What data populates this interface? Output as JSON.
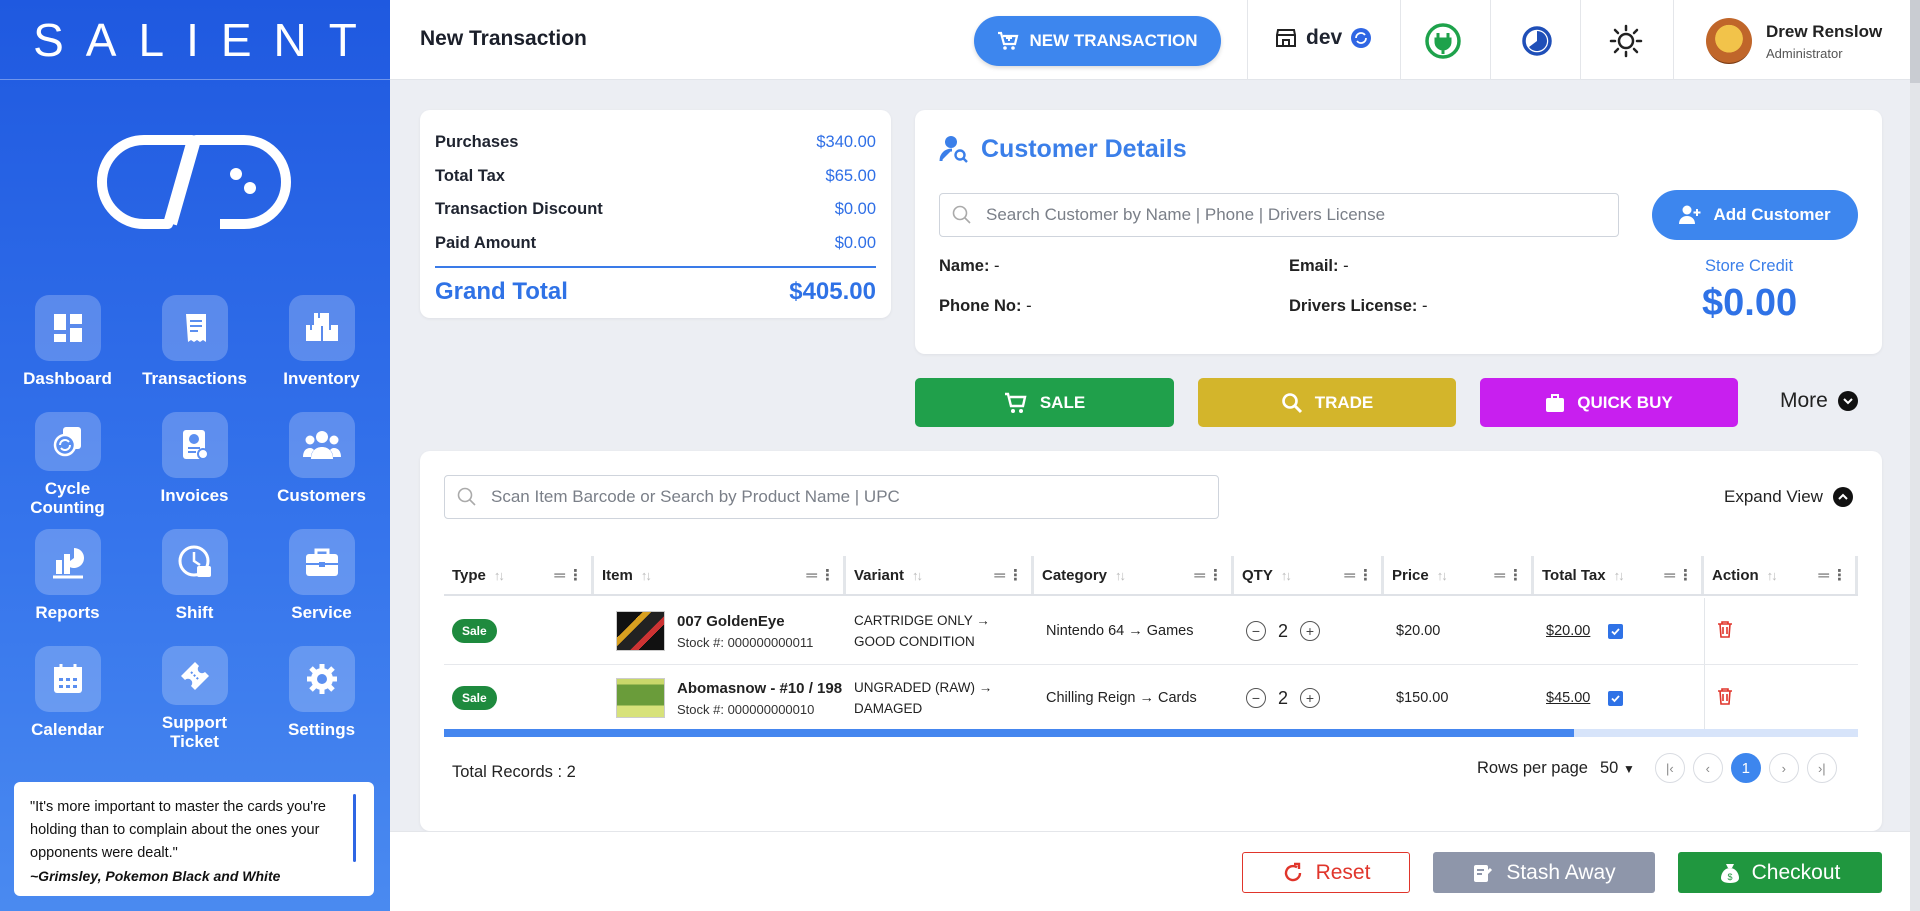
{
  "brand": {
    "name": "SALIENT"
  },
  "nav": [
    {
      "label": "Dashboard",
      "icon": "dashboard-icon"
    },
    {
      "label": "Transactions",
      "icon": "receipt-icon"
    },
    {
      "label": "Inventory",
      "icon": "boxes-icon"
    },
    {
      "label": "Cycle\nCounting",
      "icon": "cycle-counting-icon"
    },
    {
      "label": "Invoices",
      "icon": "invoice-icon"
    },
    {
      "label": "Customers",
      "icon": "users-icon"
    },
    {
      "label": "Reports",
      "icon": "chart-icon"
    },
    {
      "label": "Shift",
      "icon": "clock-icon"
    },
    {
      "label": "Service",
      "icon": "toolbox-icon"
    },
    {
      "label": "Calendar",
      "icon": "calendar-icon"
    },
    {
      "label": "Support\nTicket",
      "icon": "ticket-icon"
    },
    {
      "label": "Settings",
      "icon": "gear-icon"
    }
  ],
  "quote": {
    "text": "\"It's more important to master the cards you're holding than to complain about the ones your opponents were dealt.\"",
    "author": "~Grimsley, Pokemon Black and White"
  },
  "header": {
    "title": "New Transaction",
    "new_tx_label": "NEW TRANSACTION",
    "store": "dev",
    "user_name": "Drew Renslow",
    "user_role": "Administrator"
  },
  "summary": {
    "rows": [
      {
        "label": "Purchases",
        "value": "$340.00"
      },
      {
        "label": "Total Tax",
        "value": "$65.00"
      },
      {
        "label": "Transaction Discount",
        "value": "$0.00"
      },
      {
        "label": "Paid Amount",
        "value": "$0.00"
      }
    ],
    "grand_label": "Grand Total",
    "grand_value": "$405.00"
  },
  "customer": {
    "title": "Customer Details",
    "search_placeholder": "Search Customer by Name | Phone | Drivers License",
    "add_label": "Add Customer",
    "name_label": "Name:",
    "name_value": "-",
    "email_label": "Email:",
    "email_value": "-",
    "phone_label": "Phone No:",
    "phone_value": "-",
    "license_label": "Drivers License:",
    "license_value": "-",
    "credit_label": "Store Credit",
    "credit_value": "$0.00"
  },
  "actions": {
    "sale": "SALE",
    "trade": "TRADE",
    "quick_buy": "QUICK BUY",
    "more": "More",
    "colors": {
      "sale": "#20a04b",
      "trade": "#d3b52b",
      "quick_buy": "#c81fef"
    }
  },
  "table": {
    "search_placeholder": "Scan Item Barcode or Search by Product Name | UPC",
    "expand_label": "Expand View",
    "columns": [
      "Type",
      "Item",
      "Variant",
      "Category",
      "QTY",
      "Price",
      "Total Tax",
      "Action"
    ],
    "rows": [
      {
        "type": "Sale",
        "item": "007 GoldenEye",
        "stock": "Stock #: 000000000011",
        "variant1": "CARTRIDGE ONLY →",
        "variant2": "GOOD CONDITION",
        "category": "Nintendo 64 → Games",
        "qty": "2",
        "price": "$20.00",
        "tax": "$20.00"
      },
      {
        "type": "Sale",
        "item": "Abomasnow - #10 / 198",
        "stock": "Stock #: 000000000010",
        "variant1": "UNGRADED (RAW) →",
        "variant2": "DAMAGED",
        "category": "Chilling Reign → Cards",
        "qty": "2",
        "price": "$150.00",
        "tax": "$45.00"
      }
    ],
    "total_records": "Total Records : 2",
    "rows_per_page_label": "Rows per page",
    "rows_per_page": "50",
    "current_page": "1"
  },
  "footer": {
    "reset": "Reset",
    "stash": "Stash Away",
    "checkout": "Checkout"
  }
}
